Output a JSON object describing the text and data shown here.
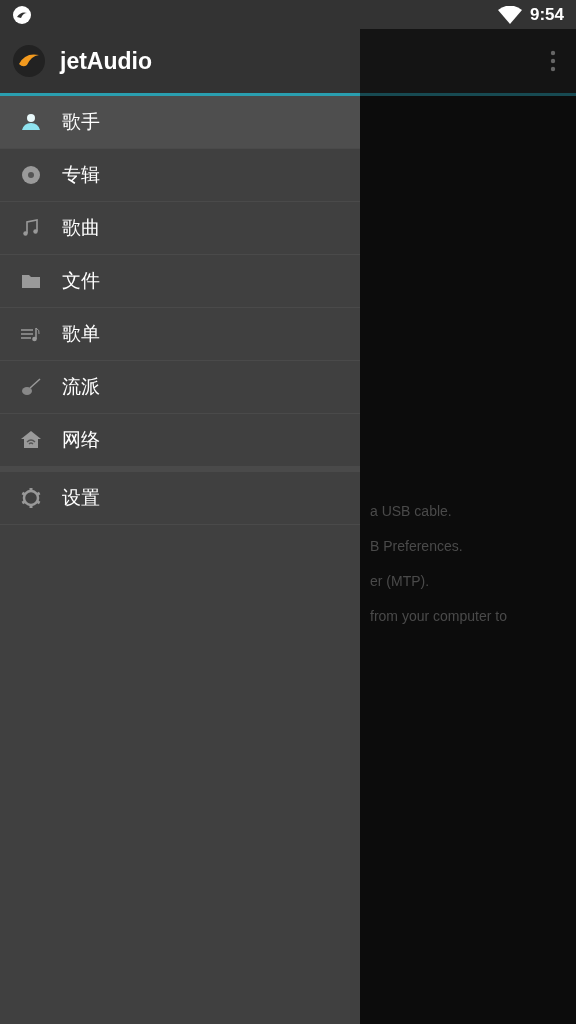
{
  "status_bar": {
    "time": "9:54"
  },
  "drawer": {
    "app_name": "jetAudio",
    "groups": [
      {
        "items": [
          {
            "label": "歌手",
            "selected": true
          },
          {
            "label": "专辑",
            "selected": false
          },
          {
            "label": "歌曲",
            "selected": false
          },
          {
            "label": "文件",
            "selected": false
          },
          {
            "label": "歌单",
            "selected": false
          },
          {
            "label": "流派",
            "selected": false
          },
          {
            "label": "网络",
            "selected": false
          }
        ]
      },
      {
        "items": [
          {
            "label": "设置",
            "selected": false
          }
        ]
      }
    ]
  },
  "background": {
    "lines": [
      "a USB cable.",
      "B Preferences.",
      "er (MTP).",
      "from your computer to"
    ]
  }
}
